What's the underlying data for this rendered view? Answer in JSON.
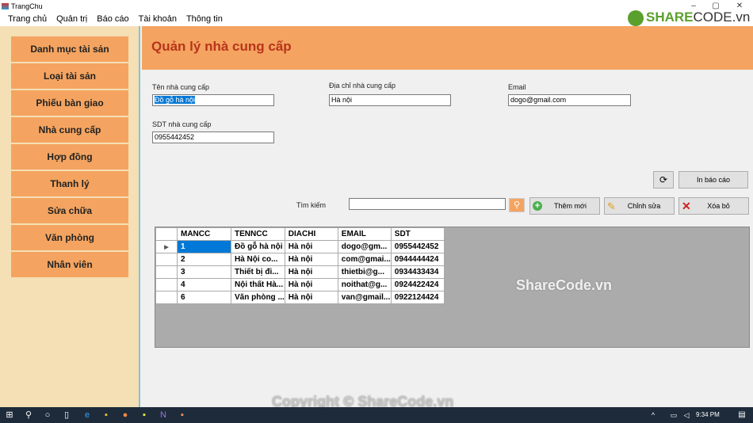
{
  "window": {
    "title": "TrangChu"
  },
  "menu": [
    "Trang chủ",
    "Quản trị",
    "Báo cáo",
    "Tài khoản",
    "Thông tin"
  ],
  "sidebar": [
    "Danh mục tài sản",
    "Loại tài sản",
    "Phiếu bàn giao",
    "Nhà cung cấp",
    "Hợp đồng",
    "Thanh lý",
    "Sửa chữa",
    "Văn phòng",
    "Nhân viên"
  ],
  "header": {
    "title": "Quản lý nhà cung cấp"
  },
  "form": {
    "name_label": "Tên nhà cung cấp",
    "name_value": "Đồ gỗ hà nội",
    "address_label": "Địa chỉ nhà cung cấp",
    "address_value": "Hà nội",
    "email_label": "Email",
    "email_value": "dogo@gmail.com",
    "phone_label": "SDT nhà cung cấp",
    "phone_value": "0955442452"
  },
  "toolbar": {
    "refresh_icon": "refresh-icon",
    "print": "In báo cáo",
    "search_label": "Tìm kiếm",
    "search_value": "",
    "add": "Thêm mới",
    "edit": "Chỉnh sửa",
    "delete": "Xóa bỏ"
  },
  "table": {
    "columns": [
      "MANCC",
      "TENNCC",
      "DIACHI",
      "EMAIL",
      "SDT"
    ],
    "rows": [
      [
        "1",
        "Đồ gỗ hà nội",
        "Hà nội",
        "dogo@gm...",
        "0955442452"
      ],
      [
        "2",
        "Hà Nội co...",
        "Hà nội",
        "com@gmai...",
        "0944444424"
      ],
      [
        "3",
        "Thiết bị đi...",
        "Hà nội",
        "thietbi@g...",
        "0934433434"
      ],
      [
        "4",
        "Nội thất Hà...",
        "Hà nội",
        "noithat@g...",
        "0924422424"
      ],
      [
        "6",
        "Văn phòng ...",
        "Hà nội",
        "van@gmail...",
        "0922124424"
      ]
    ]
  },
  "watermark": {
    "logo": "SHARECODE.vn",
    "center": "ShareCode.vn",
    "copyright": "Copyright © ShareCode.vn"
  },
  "taskbar": {
    "time": "9:34 PM"
  },
  "colors": {
    "accent": "#f4a460",
    "title": "#b8341b",
    "sidebar": "#f5dfb5"
  }
}
